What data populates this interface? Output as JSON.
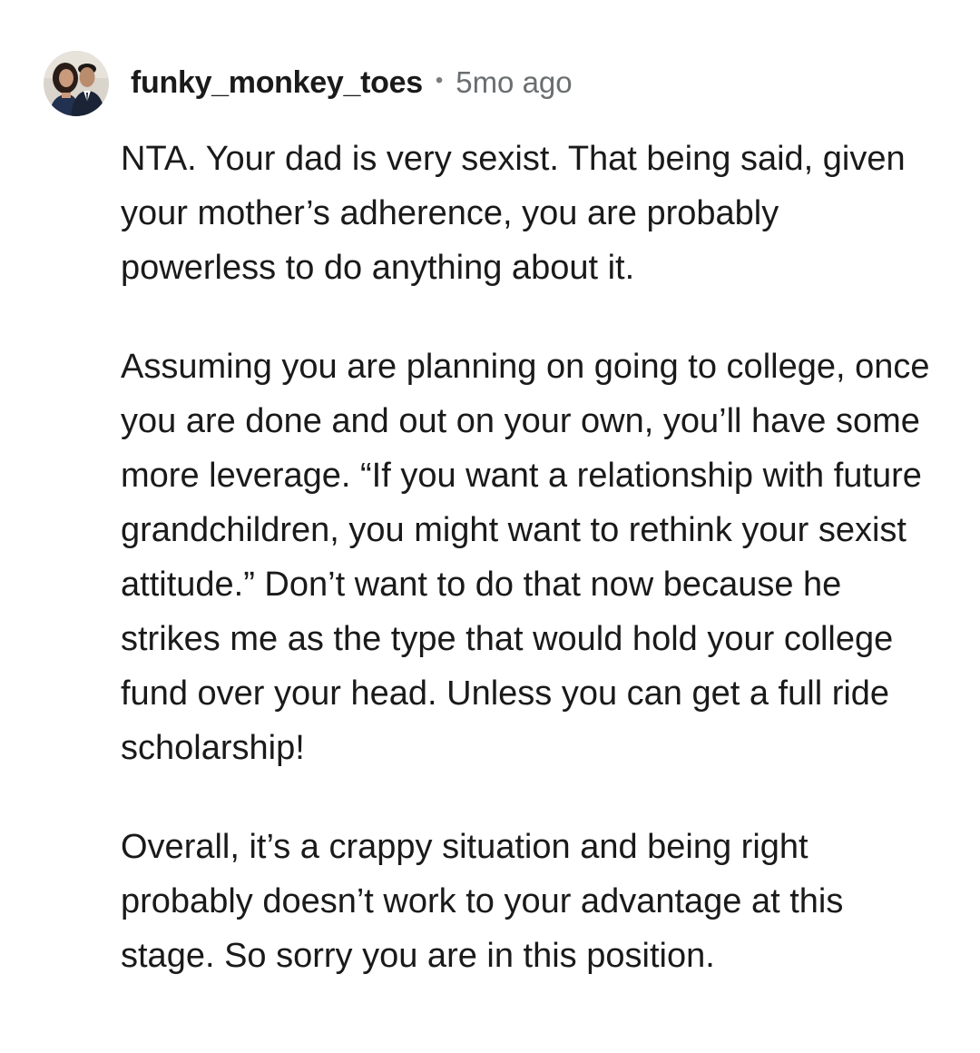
{
  "comment": {
    "author": "funky_monkey_toes",
    "separator": "•",
    "age": "5mo ago",
    "avatar_icon": "user-avatar-photo",
    "paragraphs": [
      "NTA. Your dad is very sexist. That being said, given your mother’s adherence, you are probably powerless to do anything about it.",
      "Assuming you are planning on going to college, once you are done and out on your own, you’ll have some more leverage. “If you want a relationship with future grandchildren, you might want to rethink your sexist attitude.” Don’t want to do that now because he strikes me as the type that would hold your college fund over your head. Unless you can get a full ride scholarship!",
      "Overall, it’s a crappy situation and being right probably doesn’t work to your advantage at this stage. So sorry you are in this position."
    ]
  },
  "colors": {
    "text": "#1a1a1b",
    "meta": "#6b6e70",
    "background": "#ffffff"
  }
}
